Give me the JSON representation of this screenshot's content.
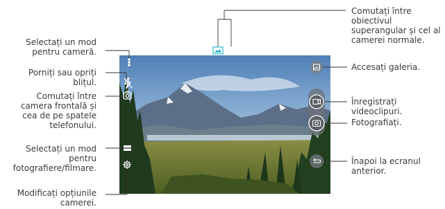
{
  "callouts": {
    "mode": [
      "Selectați un mod",
      "pentru cameră."
    ],
    "flash": [
      "Porniți sau opriți",
      "blițul."
    ],
    "switch_camera": [
      "Comutați între",
      "camera frontală și",
      "cea de pe spatele",
      "telefonului."
    ],
    "shoot_mode": [
      "Selectați un mod",
      "pentru",
      "fotografiere/filmare."
    ],
    "settings": [
      "Modificați opțiunile",
      "camerei."
    ],
    "lens": [
      "Comutați între",
      "obiectivul",
      "superangular și cel al",
      "camerei normale."
    ],
    "gallery": [
      "Accesați galeria."
    ],
    "record": [
      "Înregistrați",
      "videoclipuri."
    ],
    "photo": [
      "Fotografiați."
    ],
    "back": [
      "Înapoi la ecranul",
      "anterior."
    ]
  },
  "icons": {
    "mode": "more-dots-icon",
    "flash": "flash-off-icon",
    "switch": "switch-camera-icon",
    "shoot": "shooting-mode-icon",
    "settings": "gear-icon",
    "lens_wide": "wide-angle-lens-icon",
    "lens_normal": "normal-lens-icon",
    "gallery": "gallery-icon",
    "record": "video-record-icon",
    "capture": "camera-capture-icon",
    "back": "back-arrow-icon"
  },
  "colors": {
    "accent": "#2bb5c8",
    "leader": "#333333"
  }
}
